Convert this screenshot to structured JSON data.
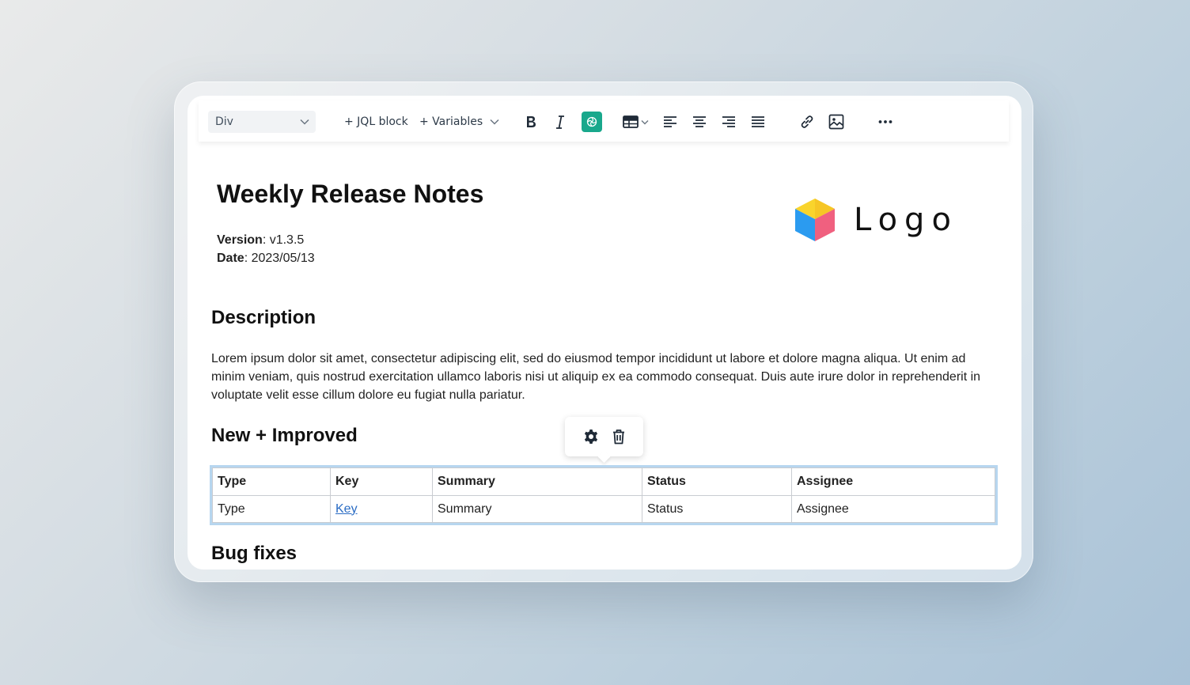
{
  "toolbar": {
    "block_select": "Div",
    "jql_block_label": "+ JQL block",
    "variables_label": "+ Variables",
    "accent_color": "#19a88c"
  },
  "document": {
    "title": "Weekly Release Notes",
    "version_label": "Version",
    "version_value": ": v1.3.5",
    "date_label": "Date",
    "date_value": ": 2023/05/13",
    "logo_text": "Logo",
    "description_heading": "Description",
    "description_text": "Lorem ipsum dolor sit amet, consectetur adipiscing elit, sed do eiusmod tempor incididunt ut labore et dolore magna aliqua. Ut enim ad minim veniam, quis nostrud exercitation ullamco laboris nisi ut aliquip ex ea commodo consequat. Duis aute irure dolor in reprehenderit in voluptate velit esse cillum dolore eu fugiat nulla pariatur.",
    "new_improved_heading": "New + Improved",
    "bug_fixes_heading": "Bug fixes"
  },
  "table": {
    "headers": [
      "Type",
      "Key",
      "Summary",
      "Status",
      "Assignee"
    ],
    "row": [
      "Type",
      "Key",
      "Summary",
      "Status",
      "Assignee"
    ]
  },
  "icons": {
    "popover": [
      "gear-icon",
      "trash-icon"
    ],
    "toolbar": [
      "bold-icon",
      "italic-icon",
      "ai-assistant-icon",
      "table-icon",
      "align-left-icon",
      "align-center-icon",
      "align-right-icon",
      "align-justify-icon",
      "link-icon",
      "image-icon",
      "more-icon"
    ]
  }
}
